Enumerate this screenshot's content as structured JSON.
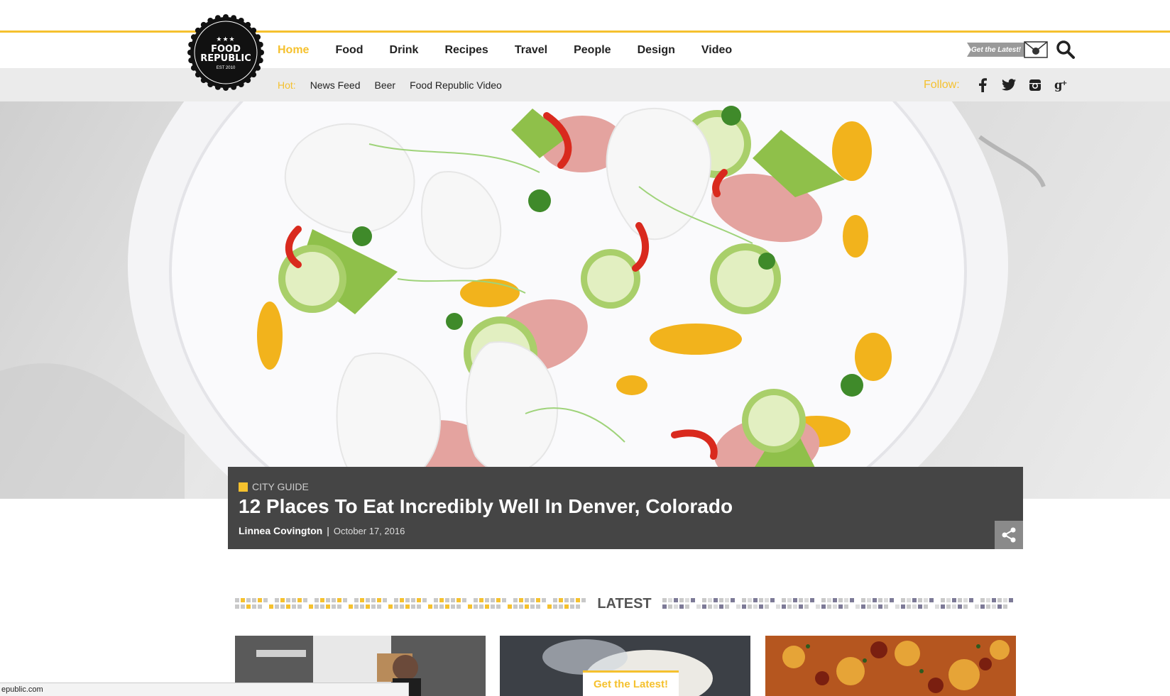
{
  "logo": {
    "stars": "★★★",
    "line1": "FOOD",
    "line2": "REPUBLIC",
    "est": "EST 2010"
  },
  "nav": {
    "items": [
      "Home",
      "Food",
      "Drink",
      "Recipes",
      "Travel",
      "People",
      "Design",
      "Video"
    ],
    "active": "Home"
  },
  "header_tools": {
    "get_latest_badge": "Get the Latest!",
    "mail_icon": "mail-icon",
    "search_icon": "search-icon"
  },
  "hot": {
    "label": "Hot:",
    "links": [
      "News Feed",
      "Beer",
      "Food Republic Video"
    ]
  },
  "follow": {
    "label": "Follow:",
    "icons": [
      "facebook-icon",
      "twitter-icon",
      "instagram-icon",
      "google-plus-icon"
    ]
  },
  "hero": {
    "category": "CITY GUIDE",
    "title": "12 Places To Eat Incredibly Well In Denver, Colorado",
    "author": "Linnea Covington",
    "separator": "|",
    "date": "October 17, 2016",
    "share_icon": "share-icon"
  },
  "latest": {
    "label": "LATEST"
  },
  "floating_button": {
    "label": "Get the Latest!"
  },
  "status_bar": {
    "url": "epublic.com"
  },
  "colors": {
    "accent": "#f5c12e",
    "caption_bg": "#454545",
    "subnav_bg": "#ebebeb"
  }
}
